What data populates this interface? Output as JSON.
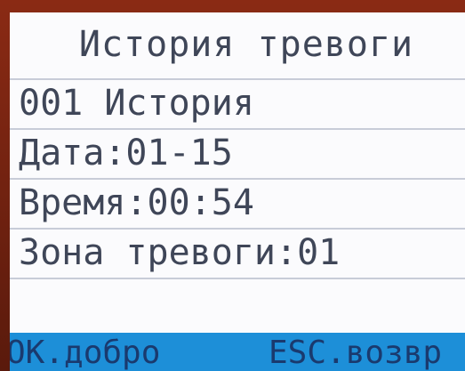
{
  "screen": {
    "title": "История тревоги",
    "rows": [
      "001 История",
      "Дата:01-15",
      "Время:00:54",
      "Зона тревоги:01",
      ""
    ]
  },
  "softkeys": {
    "ok_label": "OK.добро",
    "esc_label": "ESC.возвр"
  },
  "colors": {
    "text": "#3f4658",
    "softkey_bar": "#1d8fd8",
    "separator": "#c8ccd8"
  }
}
